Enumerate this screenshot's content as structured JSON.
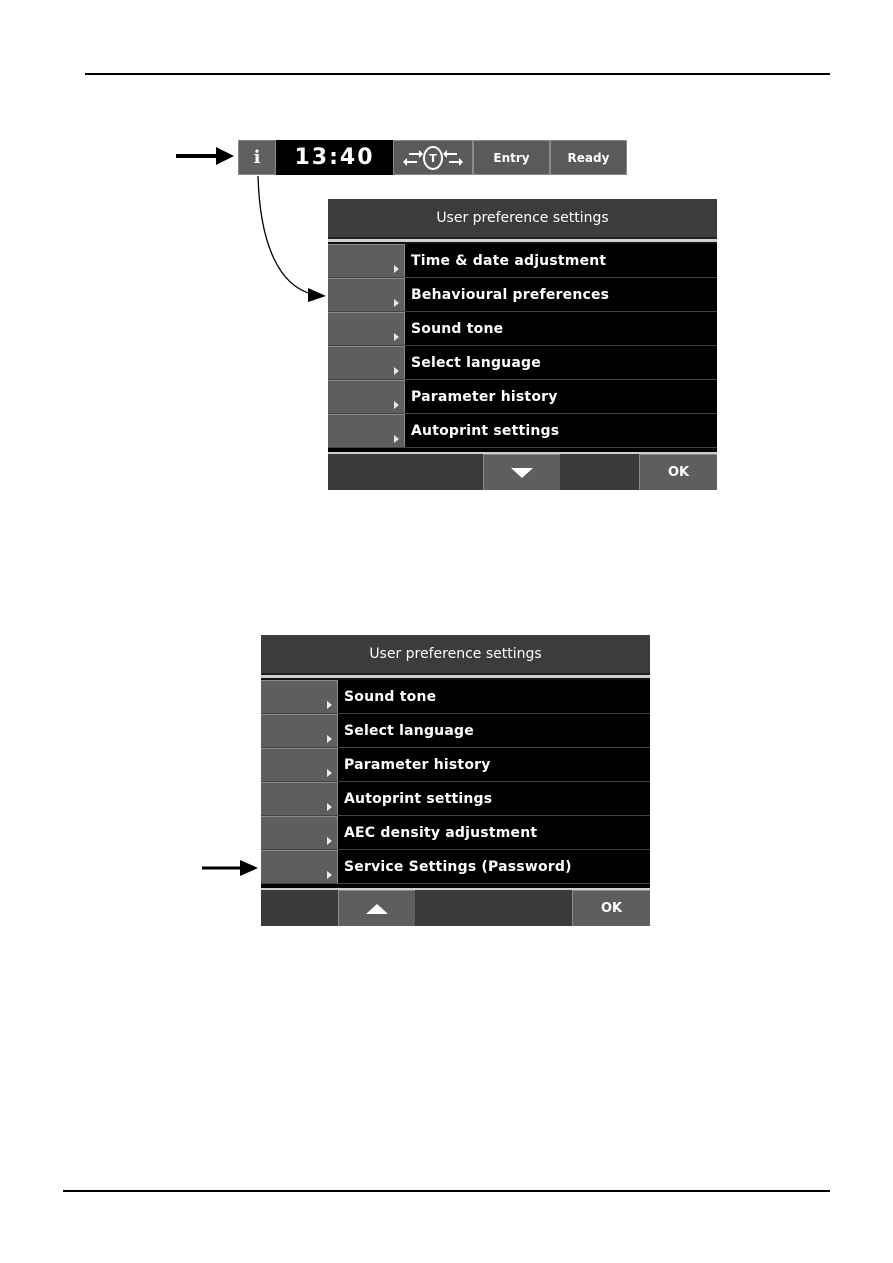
{
  "status_bar": {
    "info_icon": "info-icon",
    "info_label": "i",
    "clock": "13:40",
    "transfer_icon": "transfer-t-icon",
    "transfer_label": "T",
    "entry_label": "Entry",
    "ready_label": "Ready"
  },
  "panel_1": {
    "title": "User preference settings",
    "items": [
      {
        "label": "Time & date adjustment"
      },
      {
        "label": "Behavioural preferences"
      },
      {
        "label": "Sound tone"
      },
      {
        "label": "Select language"
      },
      {
        "label": "Parameter history"
      },
      {
        "label": "Autoprint settings"
      }
    ],
    "scroll_button_icon": "scroll-down-icon",
    "ok_label": "OK"
  },
  "panel_2": {
    "title": "User preference settings",
    "items": [
      {
        "label": "Sound tone"
      },
      {
        "label": "Select language"
      },
      {
        "label": "Parameter history"
      },
      {
        "label": "Autoprint settings"
      },
      {
        "label": "AEC density adjustment"
      },
      {
        "label": "Service Settings (Password)"
      }
    ],
    "scroll_button_icon": "scroll-up-icon",
    "ok_label": "OK"
  },
  "colors": {
    "panel_bg": "#3a3a3a",
    "row_bg": "#000000",
    "button_gray": "#5e5e5e",
    "text": "#ffffff"
  }
}
